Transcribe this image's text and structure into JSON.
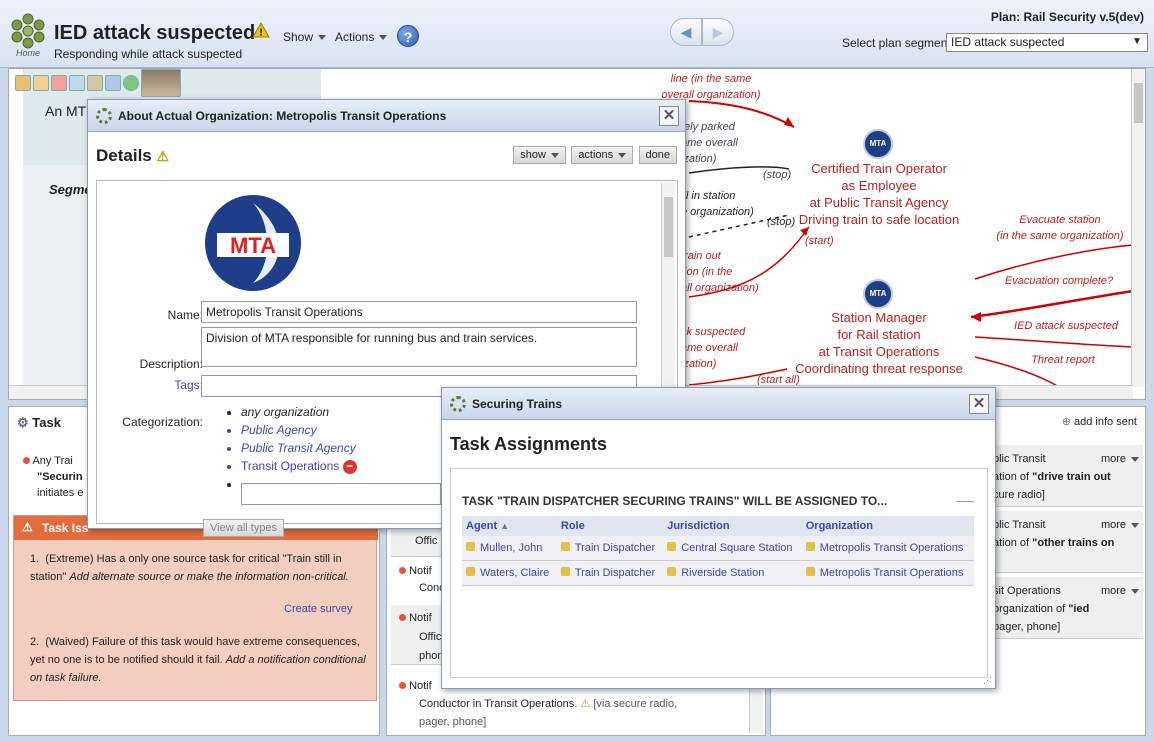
{
  "header": {
    "home_label": "Home",
    "title": "IED attack suspected",
    "subtitle": "Responding while attack suspected",
    "menu_show": "Show",
    "menu_actions": "Actions",
    "help": "?",
    "plan_name": "Plan: Rail Security v.5(dev)",
    "segment_label": "Select plan segment:",
    "segment_value": "IED attack suspected"
  },
  "flow": {
    "segment_text": "An MTC",
    "segment_label": "Segme",
    "labels": {
      "line_same_org": "line (in the same\noverall organization)",
      "safely_parked": "fely parked\name overall\nization)",
      "stop1": "(stop)",
      "still_in_station": "ill in station\ne organization)",
      "stop2": "(stop)",
      "start1": "(start)",
      "train_out": "train out\ntion (in the\nall organization)",
      "attack_suspected_left": "ck suspected\name overall\nization)",
      "start_all": "(start all)",
      "evacuate_station": "Evacuate station\n(in the same organization)",
      "evacuation_complete": "Evacuation complete?",
      "ied_attack_suspected": "IED attack suspected",
      "threat_report": "Threat report"
    },
    "node1": [
      "Certified Train Operator",
      "as Employee",
      "at Public Transit Agency",
      "Driving train to safe location"
    ],
    "node2": [
      "Station Manager",
      "for Rail station",
      "at Transit Operations",
      "Coordinating threat response"
    ]
  },
  "task_panel": {
    "title": "Task",
    "summary_lines": [
      "Any Trai",
      "\"Securin",
      "initiates e"
    ],
    "issues_title": "Task Iss",
    "issues": [
      {
        "severity": "(Extreme)",
        "text": "Has a only one source task for critical \"Train still in station\"",
        "remedy": "Add alternate source or make the information non-critical."
      },
      {
        "severity": "(Waived)",
        "text": "Failure of this task would have extreme consequences, yet no one is to be notified should it fail.",
        "remedy": "Add a notification conditional on task failure."
      }
    ],
    "create_survey": "Create survey"
  },
  "middle_panel": {
    "rows": [
      "Offic",
      "Notif",
      "Conc",
      "Notif",
      "Office",
      "phon",
      "Notif"
    ],
    "last_row": [
      "Conductor in Transit Operations.",
      "[via secure radio,",
      "pager, phone]"
    ]
  },
  "right_panel": {
    "add_info": "add info sent",
    "items": [
      {
        "line1": "blic Transit",
        "line2a": "ation of ",
        "line2b": "\"drive train out",
        "line3": "cure radio]",
        "more": "more"
      },
      {
        "line1": "blic Transit",
        "line2a": "ation of ",
        "line2b": "\"other trains on",
        "line3": "",
        "more": "more"
      },
      {
        "line1": "sit Operations",
        "line2a": "organization of ",
        "line2b": "\"ied",
        "line3": "pager, phone]",
        "more": "more"
      }
    ]
  },
  "about_dialog": {
    "title": "About Actual Organization: Metropolis Transit Operations",
    "heading": "Details",
    "btn_show": "show",
    "btn_actions": "actions",
    "btn_done": "done",
    "logo_text": "MTA",
    "name_label": "Name:",
    "name_value": "Metropolis Transit Operations",
    "description_label": "Description:",
    "description_value": "Division of MTA responsible for running bus and train services.",
    "tags_label": "Tags:",
    "categorization_label": "Categorization:",
    "categories": [
      "any organization",
      "Public Agency",
      "Public Transit Agency",
      "Transit Operations"
    ],
    "view_all_types": "View all types"
  },
  "assign_dialog": {
    "title": "Securing Trains",
    "heading": "Task Assignments",
    "subheading": "TASK \"TRAIN DISPATCHER SECURING TRAINS\" WILL BE ASSIGNED TO...",
    "columns": [
      "Agent",
      "Role",
      "Jurisdiction",
      "Organization"
    ],
    "rows": [
      [
        "Mullen, John",
        "Train Dispatcher",
        "Central Square Station",
        "Metropolis Transit Operations"
      ],
      [
        "Waters, Claire",
        "Train Dispatcher",
        "Riverside Station",
        "Metropolis Transit Operations"
      ]
    ]
  }
}
